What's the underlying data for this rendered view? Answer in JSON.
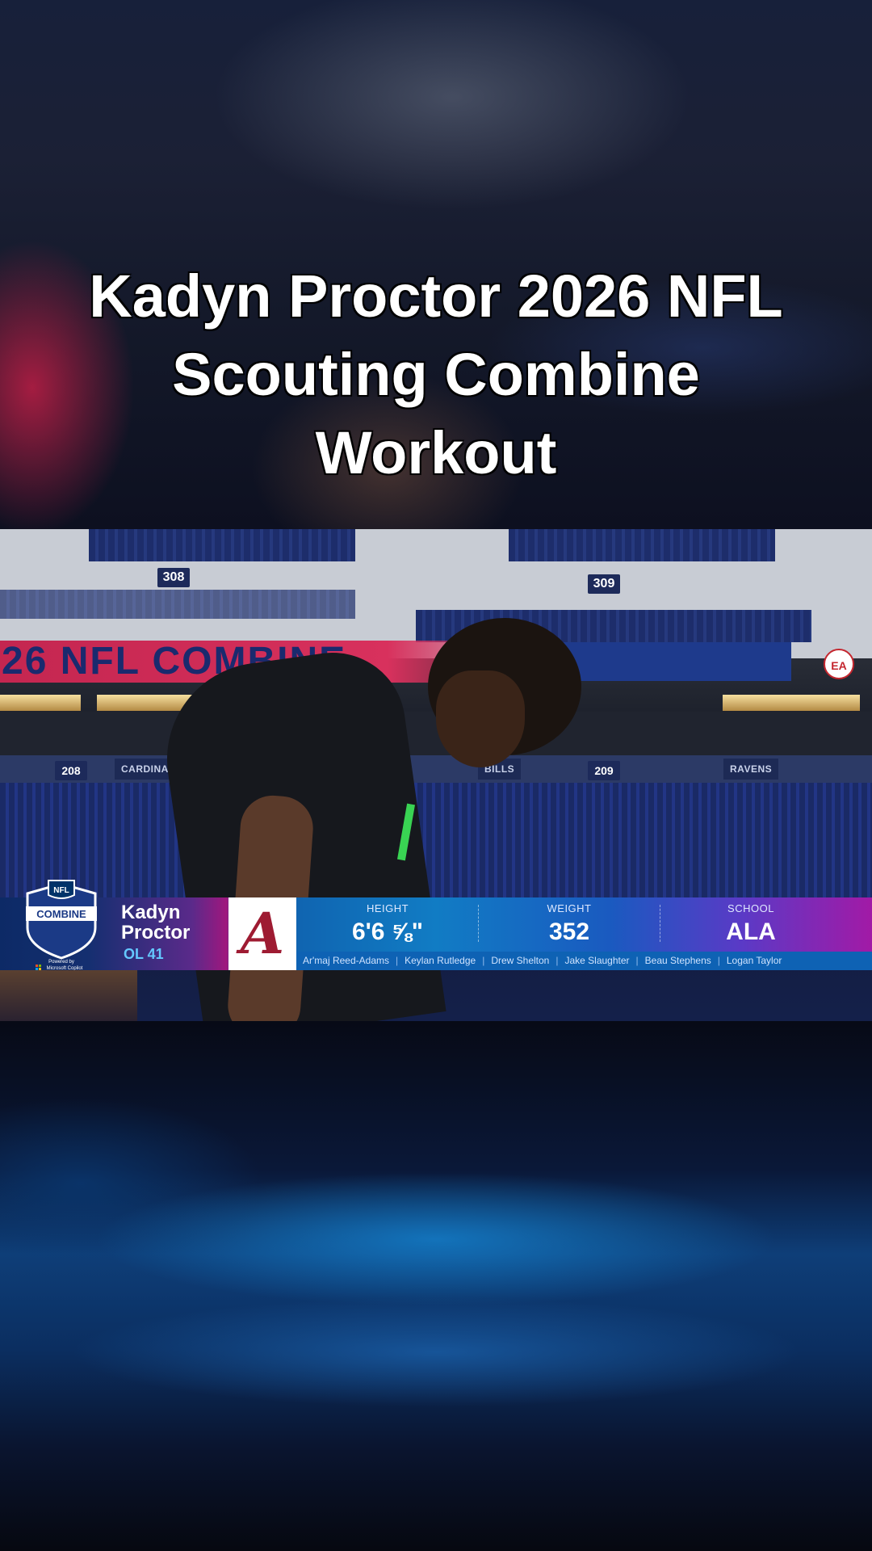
{
  "title": {
    "line1": "Kadyn Proctor 2026 NFL",
    "line2": "Scouting Combine",
    "line3": "Workout"
  },
  "scene": {
    "banner_text": "26 NFL COMBINE",
    "section_signs": [
      "308",
      "309",
      "208",
      "209"
    ],
    "team_tags": [
      "CARDINALS",
      "BILLS",
      "RAVENS"
    ],
    "ea_badge": "EA"
  },
  "graphic": {
    "combine_logo": {
      "nfl": "NFL",
      "word": "COMBINE",
      "sponsor_line1": "Powered by",
      "sponsor_line2": "Microsoft Copilot"
    },
    "player": {
      "first_name": "Kadyn",
      "last_name": "Proctor",
      "position": "OL 41"
    },
    "school_logo_letter": "A",
    "stats": [
      {
        "label": "HEIGHT",
        "value": "6'6 ⅝\""
      },
      {
        "label": "WEIGHT",
        "value": "352"
      },
      {
        "label": "SCHOOL",
        "value": "ALA"
      }
    ],
    "ticker": [
      "Ar'maj Reed-Adams",
      "Keylan Rutledge",
      "Drew Shelton",
      "Jake Slaughter",
      "Beau Stephens",
      "Logan Taylor"
    ]
  },
  "colors": {
    "alabama_crimson": "#9e1b32",
    "position_blue": "#64c8ff"
  }
}
